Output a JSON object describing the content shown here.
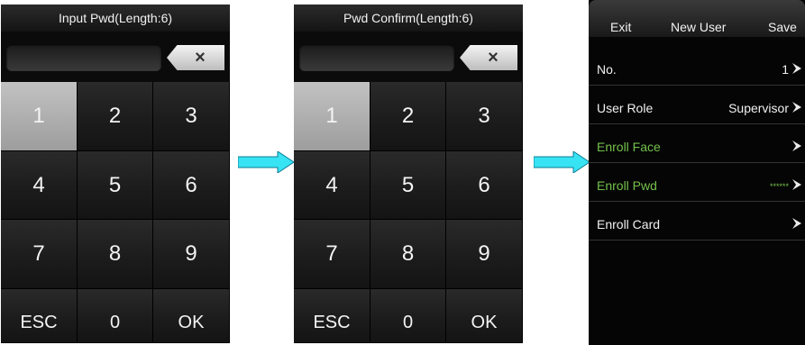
{
  "screen1": {
    "title": "Input Pwd(Length:6)",
    "clear_label": "×",
    "keys": [
      "1",
      "2",
      "3",
      "4",
      "5",
      "6",
      "7",
      "8",
      "9",
      "ESC",
      "0",
      "OK"
    ]
  },
  "screen2": {
    "title": "Pwd Confirm(Length:6)",
    "clear_label": "×",
    "keys": [
      "1",
      "2",
      "3",
      "4",
      "5",
      "6",
      "7",
      "8",
      "9",
      "ESC",
      "0",
      "OK"
    ]
  },
  "menu": {
    "header": {
      "exit": "Exit",
      "title": "New User",
      "save": "Save"
    },
    "rows": [
      {
        "label": "No.",
        "value": "1"
      },
      {
        "label": "User Role",
        "value": "Supervisor"
      },
      {
        "label": "Enroll Face",
        "value": ""
      },
      {
        "label": "Enroll Pwd",
        "value": "******"
      },
      {
        "label": "Enroll Card",
        "value": ""
      }
    ]
  },
  "colors": {
    "accent_green": "#73c04a",
    "arrow_cyan": "#38e3f3",
    "selected_key": "#b5b5b5"
  },
  "icons": [
    "clear-x-icon",
    "chevron-right-icon",
    "right-arrow-icon"
  ]
}
